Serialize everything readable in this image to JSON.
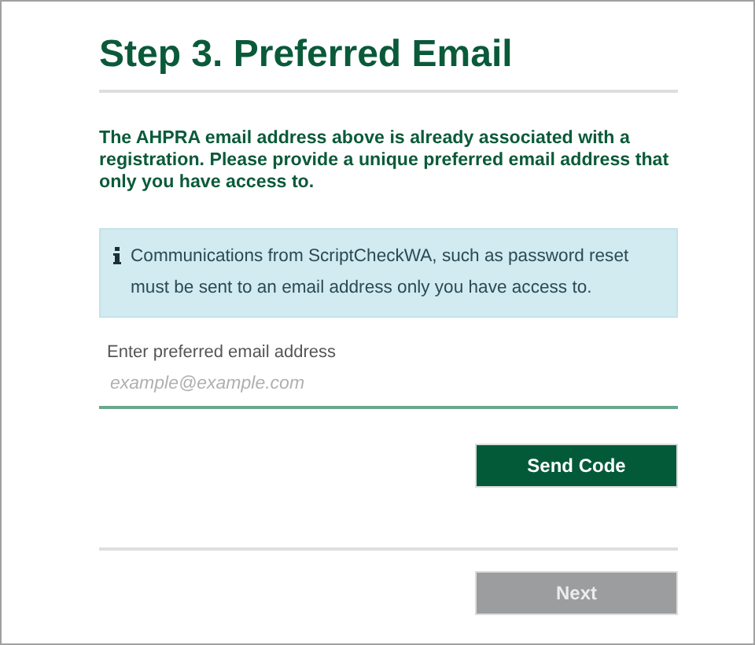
{
  "title": "Step 3. Preferred Email",
  "intro": "The AHPRA email address above is already associated with a registration. Please provide a unique preferred email address that only you have access to.",
  "info": {
    "text": "Communications from ScriptCheckWA, such as password reset must be sent to an email address only you have access to."
  },
  "email_field": {
    "label": "Enter preferred email address",
    "placeholder": "example@example.com",
    "focused": true
  },
  "send_button": {
    "label": "Send Code",
    "disabled": false
  },
  "next_button": {
    "label": "Next",
    "disabled": true
  }
}
